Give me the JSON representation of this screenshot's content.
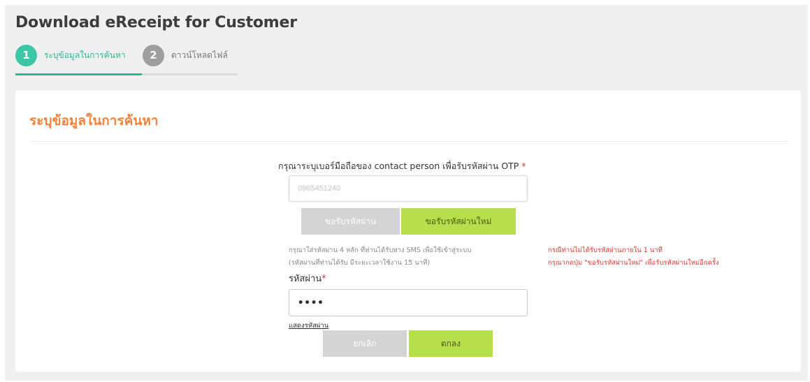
{
  "page": {
    "title": "Download eReceipt for Customer"
  },
  "stepper": {
    "steps": [
      {
        "number": "1",
        "label": "ระบุข้อมูลในการค้นหา",
        "active": true
      },
      {
        "number": "2",
        "label": "ดาวน์โหลดไฟล์",
        "active": false
      }
    ],
    "active_color": "#2bb897",
    "inactive_color": "#9e9e9e"
  },
  "form": {
    "section_title": "ระบุข้อมูลในการค้นหา",
    "phone_label": "กรุณาระบุเบอร์มือถือของ contact person เพื่อรับรหัสผ่าน OTP",
    "required_mark": "*",
    "phone_value": "0965451240",
    "request_otp_label": "ขอรับรหัสผ่าน",
    "request_new_otp_label": "ขอรับรหัสผ่านใหม่",
    "hint_line1": "กรุณาใส่รหัสผ่าน 4 หลัก ที่ท่านได้รับทาง SMS เพื่อใช้เข้าสู่ระบบ",
    "hint_line2": "(รหัสผ่านที่ท่านได้รับ มีระยะเวลาใช้งาน 15 นาที)",
    "red_hint_line1": "กรณีท่านไม่ได้รับรหัสผ่านภายใน 1 นาที",
    "red_hint_line2": "กรุณากดปุ่ม \"ขอรับรหัสผ่านใหม่\" เพื่อรับรหัสผ่านใหม่อีกครั้ง",
    "password_label": "รหัสผ่าน",
    "password_value": "••••",
    "show_password_label": "แสดงรหัสผ่าน",
    "cancel_label": "ยกเลิก",
    "ok_label": "ตกลง"
  },
  "colors": {
    "accent_orange": "#f4823d",
    "button_green": "#b6e04a",
    "button_disabled": "#d4d4d4",
    "error_red": "#e53935"
  }
}
